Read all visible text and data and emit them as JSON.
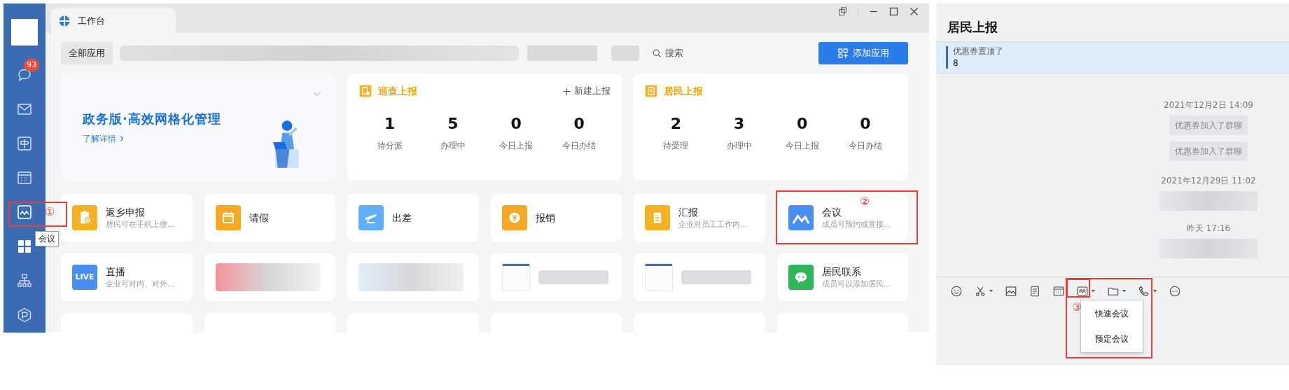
{
  "sidebar": {
    "message_badge": "93",
    "tooltip": "会议"
  },
  "tab": {
    "title": "工作台"
  },
  "toolbar": {
    "all_apps": "全部应用",
    "search": "搜索",
    "add_button": "添加应用"
  },
  "banner": {
    "title": "政务版·高效网格化管理",
    "link": "了解详情"
  },
  "stat_cards": [
    {
      "title": "巡查上报",
      "action": "新建上报",
      "stats": [
        {
          "value": "1",
          "label": "待分派"
        },
        {
          "value": "5",
          "label": "办理中"
        },
        {
          "value": "0",
          "label": "今日上报"
        },
        {
          "value": "0",
          "label": "今日办结"
        }
      ]
    },
    {
      "title": "居民上报",
      "stats": [
        {
          "value": "2",
          "label": "待受理"
        },
        {
          "value": "3",
          "label": "办理中"
        },
        {
          "value": "0",
          "label": "今日上报"
        },
        {
          "value": "0",
          "label": "今日办结"
        }
      ]
    }
  ],
  "apps": [
    {
      "kind": "app",
      "name": "返乡申报",
      "desc": "居民可在手机上便...",
      "color": "#f5b324"
    },
    {
      "kind": "app",
      "name": "请假",
      "color": "#f7a823"
    },
    {
      "kind": "app",
      "name": "出差",
      "color": "#5eaefc"
    },
    {
      "kind": "app",
      "name": "报销",
      "color": "#f7a823"
    },
    {
      "kind": "app",
      "name": "汇报",
      "desc": "企业对员工工作内...",
      "color": "#f5b324"
    },
    {
      "kind": "app",
      "name": "会议",
      "desc": "成员可预约或直接...",
      "color": "#4a8ff0"
    },
    {
      "kind": "live",
      "name": "直播",
      "desc": "企业可对内、对外...",
      "color": "#4a8ff0",
      "icon_text": "LIVE"
    },
    {
      "kind": "blurred"
    },
    {
      "kind": "blurred"
    },
    {
      "kind": "thumbnail"
    },
    {
      "kind": "thumbnail"
    },
    {
      "kind": "app",
      "name": "居民联系",
      "desc": "成员可以添加居民...",
      "color": "#2fb65a"
    }
  ],
  "annotations": [
    "①",
    "②",
    "③"
  ],
  "chat": {
    "title": "居民上报",
    "pinned": {
      "text": "优惠券置顶了",
      "count": "8"
    },
    "messages": [
      {
        "kind": "time",
        "text": "2021年12月2日 14:09"
      },
      {
        "kind": "system",
        "text": "优惠券加入了群聊"
      },
      {
        "kind": "system",
        "text": "优惠券加入了群聊"
      },
      {
        "kind": "time",
        "text": "2021年12月29日 11:02"
      },
      {
        "kind": "blurred"
      },
      {
        "kind": "time",
        "text": "昨天 17:16"
      },
      {
        "kind": "blurred"
      }
    ],
    "menu": [
      "快速会议",
      "预定会议"
    ]
  }
}
